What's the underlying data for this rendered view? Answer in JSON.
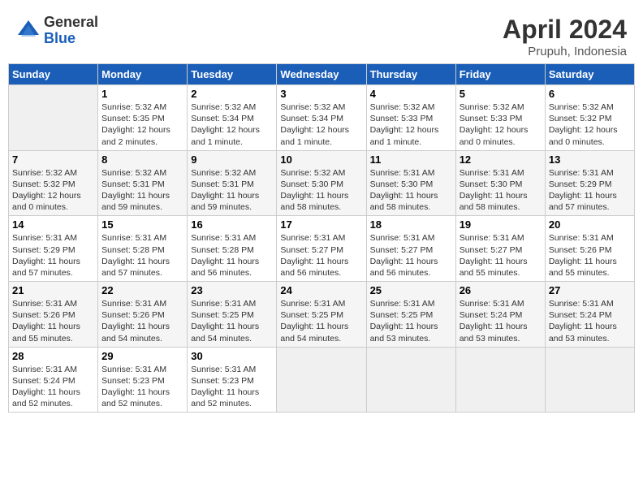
{
  "header": {
    "logo_general": "General",
    "logo_blue": "Blue",
    "month": "April 2024",
    "location": "Prupuh, Indonesia"
  },
  "days_of_week": [
    "Sunday",
    "Monday",
    "Tuesday",
    "Wednesday",
    "Thursday",
    "Friday",
    "Saturday"
  ],
  "weeks": [
    [
      {
        "num": "",
        "info": ""
      },
      {
        "num": "1",
        "info": "Sunrise: 5:32 AM\nSunset: 5:35 PM\nDaylight: 12 hours\nand 2 minutes."
      },
      {
        "num": "2",
        "info": "Sunrise: 5:32 AM\nSunset: 5:34 PM\nDaylight: 12 hours\nand 1 minute."
      },
      {
        "num": "3",
        "info": "Sunrise: 5:32 AM\nSunset: 5:34 PM\nDaylight: 12 hours\nand 1 minute."
      },
      {
        "num": "4",
        "info": "Sunrise: 5:32 AM\nSunset: 5:33 PM\nDaylight: 12 hours\nand 1 minute."
      },
      {
        "num": "5",
        "info": "Sunrise: 5:32 AM\nSunset: 5:33 PM\nDaylight: 12 hours\nand 0 minutes."
      },
      {
        "num": "6",
        "info": "Sunrise: 5:32 AM\nSunset: 5:32 PM\nDaylight: 12 hours\nand 0 minutes."
      }
    ],
    [
      {
        "num": "7",
        "info": "Sunrise: 5:32 AM\nSunset: 5:32 PM\nDaylight: 12 hours\nand 0 minutes."
      },
      {
        "num": "8",
        "info": "Sunrise: 5:32 AM\nSunset: 5:31 PM\nDaylight: 11 hours\nand 59 minutes."
      },
      {
        "num": "9",
        "info": "Sunrise: 5:32 AM\nSunset: 5:31 PM\nDaylight: 11 hours\nand 59 minutes."
      },
      {
        "num": "10",
        "info": "Sunrise: 5:32 AM\nSunset: 5:30 PM\nDaylight: 11 hours\nand 58 minutes."
      },
      {
        "num": "11",
        "info": "Sunrise: 5:31 AM\nSunset: 5:30 PM\nDaylight: 11 hours\nand 58 minutes."
      },
      {
        "num": "12",
        "info": "Sunrise: 5:31 AM\nSunset: 5:30 PM\nDaylight: 11 hours\nand 58 minutes."
      },
      {
        "num": "13",
        "info": "Sunrise: 5:31 AM\nSunset: 5:29 PM\nDaylight: 11 hours\nand 57 minutes."
      }
    ],
    [
      {
        "num": "14",
        "info": "Sunrise: 5:31 AM\nSunset: 5:29 PM\nDaylight: 11 hours\nand 57 minutes."
      },
      {
        "num": "15",
        "info": "Sunrise: 5:31 AM\nSunset: 5:28 PM\nDaylight: 11 hours\nand 57 minutes."
      },
      {
        "num": "16",
        "info": "Sunrise: 5:31 AM\nSunset: 5:28 PM\nDaylight: 11 hours\nand 56 minutes."
      },
      {
        "num": "17",
        "info": "Sunrise: 5:31 AM\nSunset: 5:27 PM\nDaylight: 11 hours\nand 56 minutes."
      },
      {
        "num": "18",
        "info": "Sunrise: 5:31 AM\nSunset: 5:27 PM\nDaylight: 11 hours\nand 56 minutes."
      },
      {
        "num": "19",
        "info": "Sunrise: 5:31 AM\nSunset: 5:27 PM\nDaylight: 11 hours\nand 55 minutes."
      },
      {
        "num": "20",
        "info": "Sunrise: 5:31 AM\nSunset: 5:26 PM\nDaylight: 11 hours\nand 55 minutes."
      }
    ],
    [
      {
        "num": "21",
        "info": "Sunrise: 5:31 AM\nSunset: 5:26 PM\nDaylight: 11 hours\nand 55 minutes."
      },
      {
        "num": "22",
        "info": "Sunrise: 5:31 AM\nSunset: 5:26 PM\nDaylight: 11 hours\nand 54 minutes."
      },
      {
        "num": "23",
        "info": "Sunrise: 5:31 AM\nSunset: 5:25 PM\nDaylight: 11 hours\nand 54 minutes."
      },
      {
        "num": "24",
        "info": "Sunrise: 5:31 AM\nSunset: 5:25 PM\nDaylight: 11 hours\nand 54 minutes."
      },
      {
        "num": "25",
        "info": "Sunrise: 5:31 AM\nSunset: 5:25 PM\nDaylight: 11 hours\nand 53 minutes."
      },
      {
        "num": "26",
        "info": "Sunrise: 5:31 AM\nSunset: 5:24 PM\nDaylight: 11 hours\nand 53 minutes."
      },
      {
        "num": "27",
        "info": "Sunrise: 5:31 AM\nSunset: 5:24 PM\nDaylight: 11 hours\nand 53 minutes."
      }
    ],
    [
      {
        "num": "28",
        "info": "Sunrise: 5:31 AM\nSunset: 5:24 PM\nDaylight: 11 hours\nand 52 minutes."
      },
      {
        "num": "29",
        "info": "Sunrise: 5:31 AM\nSunset: 5:23 PM\nDaylight: 11 hours\nand 52 minutes."
      },
      {
        "num": "30",
        "info": "Sunrise: 5:31 AM\nSunset: 5:23 PM\nDaylight: 11 hours\nand 52 minutes."
      },
      {
        "num": "",
        "info": ""
      },
      {
        "num": "",
        "info": ""
      },
      {
        "num": "",
        "info": ""
      },
      {
        "num": "",
        "info": ""
      }
    ]
  ]
}
